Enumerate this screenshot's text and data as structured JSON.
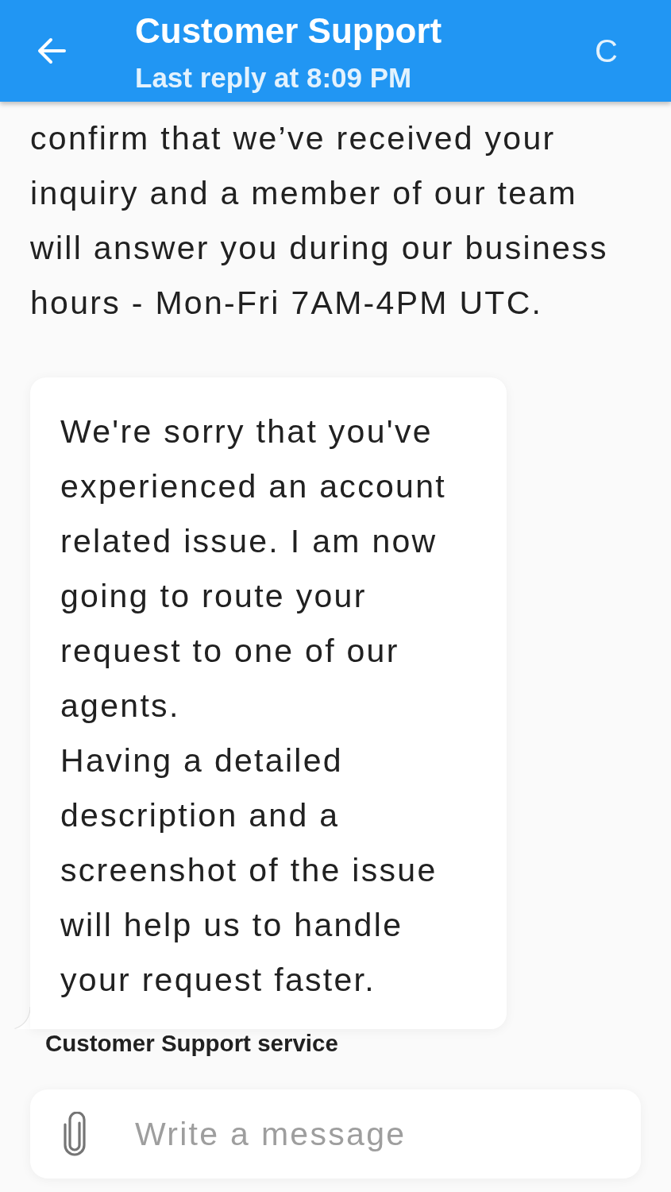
{
  "header": {
    "title": "Customer Support",
    "subtitle": "Last reply at 8:09 PM",
    "action": "C"
  },
  "messages": [
    {
      "kind": "plain",
      "text": "confirm that we’ve received your inquiry and a member of our team will answer you during our business hours - Mon-Fri 7AM-4PM UTC."
    },
    {
      "kind": "bubble",
      "text": "We're sorry that you've experienced an account related issue. I am now going to route your request to one of our agents.\nHaving a detailed description and a screenshot of the issue will help us to handle your request faster.",
      "sender": "Customer Support service"
    }
  ],
  "composer": {
    "placeholder": "Write a message"
  }
}
